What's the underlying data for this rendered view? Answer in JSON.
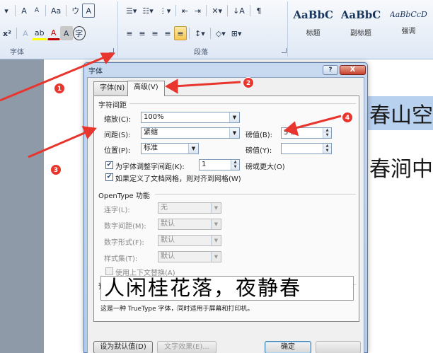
{
  "ribbon": {
    "font_row1": [
      "A",
      "A",
      "Aa",
      "ウ",
      "A"
    ],
    "font_row2": [
      "x²",
      "A",
      "ab",
      "A",
      "A",
      "字"
    ],
    "font_group_label": "字体",
    "para_group_label": "段落",
    "styles": [
      {
        "sample": "AaBbC",
        "name": "标题"
      },
      {
        "sample": "AaBbC",
        "name": "副标题"
      },
      {
        "sample": "AaBbCcD",
        "name": "强调"
      }
    ]
  },
  "document": {
    "line1": "春山空",
    "line2": "春涧中"
  },
  "dialog": {
    "title": "字体",
    "help_label": "?",
    "close_label": "X",
    "tabs": [
      {
        "label": "字体(N)",
        "active": false
      },
      {
        "label": "高级(V)",
        "active": true
      }
    ],
    "spacing_section": "字符间距",
    "scale_label": "缩放(C):",
    "scale_value": "100%",
    "spacing_label": "间距(S):",
    "spacing_value": "紧缩",
    "spacing_by_label": "磅值(B):",
    "spacing_by_value": "5 磅",
    "position_label": "位置(P):",
    "position_value": "标准",
    "position_by_label": "磅值(Y):",
    "position_by_value": "",
    "kerning_label": "为字体调整字间距(K):",
    "kerning_value": "1",
    "kerning_suffix": "磅或更大(O)",
    "kerning_checked": true,
    "grid_label": "如果定义了文档网格，则对齐到网格(W)",
    "grid_checked": true,
    "opentype_section": "OpenType 功能",
    "ligatures_label": "连字(L):",
    "ligatures_value": "无",
    "num_spacing_label": "数字间距(M):",
    "num_spacing_value": "默认",
    "num_forms_label": "数字形式(F):",
    "num_forms_value": "默认",
    "style_sets_label": "样式集(T):",
    "style_sets_value": "默认",
    "contextual_label": "使用上下文替换(A)",
    "preview_section": "预览",
    "preview_text": "人闲桂花落，夜静春",
    "note": "这是一种 TrueType 字体，同时适用于屏幕和打印机。",
    "default_button": "设为默认值(D)",
    "effects_button": "文字效果(E)...",
    "ok_button": "确定"
  },
  "annotations": [
    "1",
    "2",
    "3",
    "4"
  ],
  "colors": {
    "annotation": "#e8362e",
    "selection": "#b8d1ef"
  }
}
